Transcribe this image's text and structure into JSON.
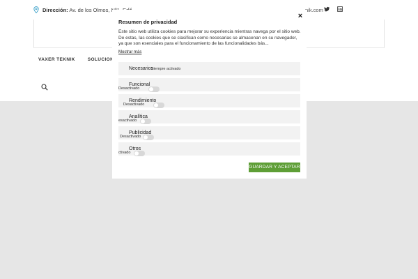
{
  "topbar": {
    "address_label": "Dirección:",
    "address_value": "Av. de los Olmos, Nº1. Edif",
    "email_tail": "nik.com",
    "icons": [
      "map-pin-icon",
      "twitter-icon",
      "linkedin-icon"
    ]
  },
  "nav": {
    "items": [
      "VAXER TEKNIK",
      "SOLUCIONES"
    ]
  },
  "modal": {
    "title": "Resumen de privacidad",
    "description": "Este sitio web utiliza cookies para mejorar su experiencia mientras navega por el sitio web. De estas, las cookies que se clasifican como necesarias se almacenan en su navegador, ya que son esenciales para el funcionamiento de las funcionalidades bás...",
    "show_more": "Mostrar más",
    "categories": [
      {
        "name": "Necesarios",
        "status": "Siempre activado"
      },
      {
        "name": "Funcional",
        "status": "Desactivado"
      },
      {
        "name": "Rendimiento",
        "status": "Desactivado"
      },
      {
        "name": "Analítica",
        "status": "esactivado"
      },
      {
        "name": "Publicidad",
        "status": "Desactivado"
      },
      {
        "name": "Otros",
        "status": "ctivado"
      }
    ],
    "save_label": "GUARDAR Y ACEPTAR",
    "close_label": "×"
  },
  "colors": {
    "accent": "#5e9e36",
    "overlay": "#e6e6e6",
    "row_bg": "#f2f2f2"
  }
}
